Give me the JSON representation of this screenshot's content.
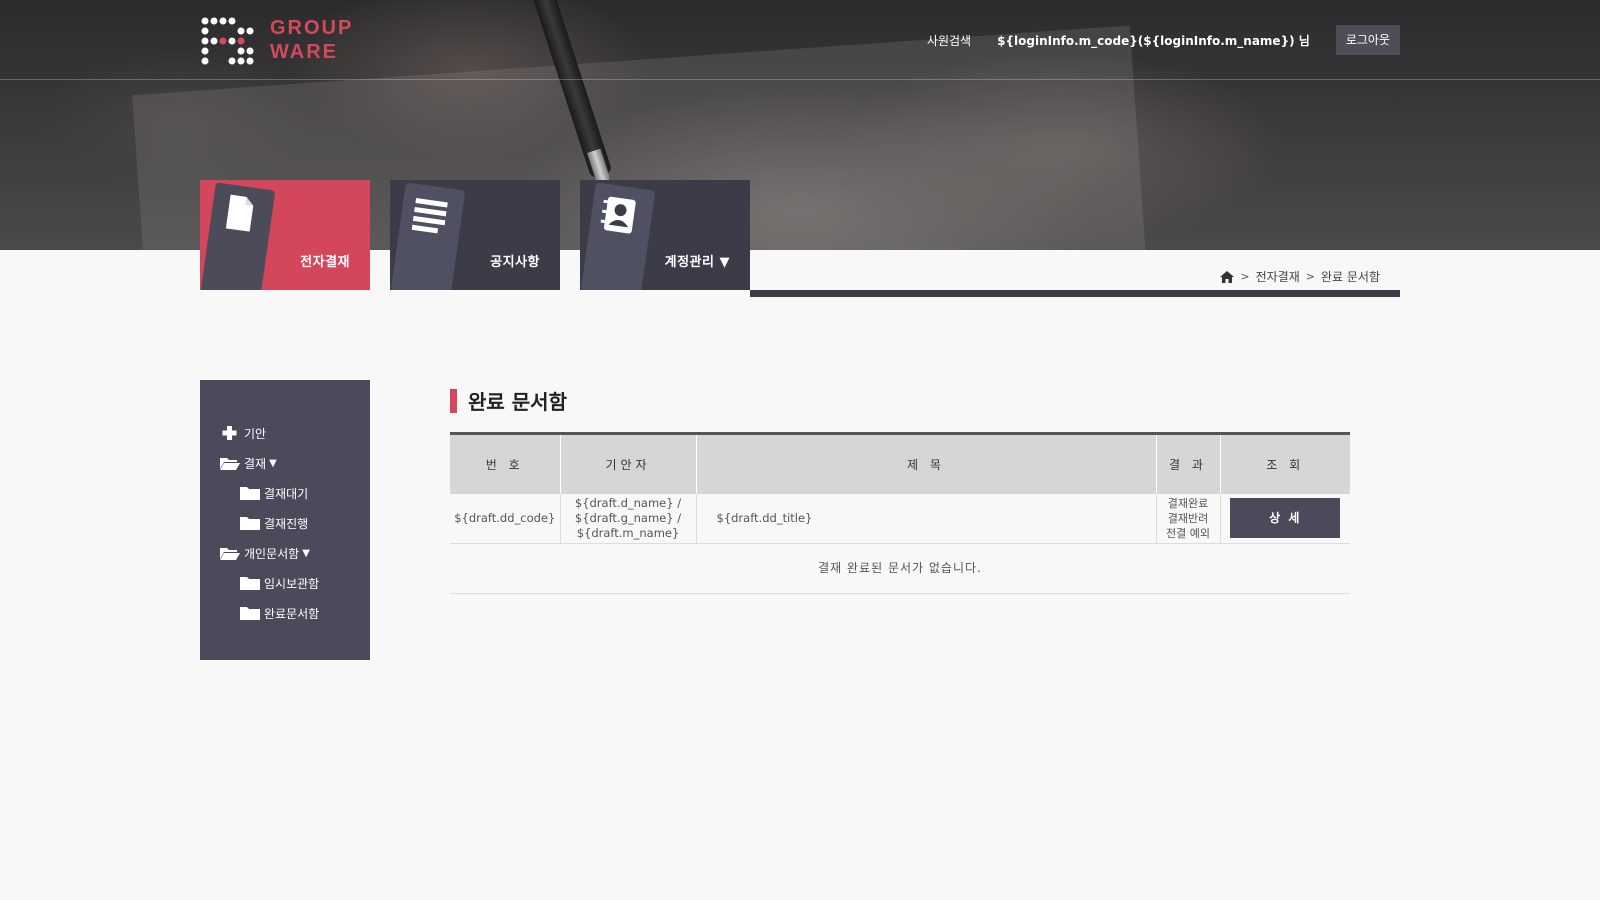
{
  "logo": {
    "line1": "GROUP",
    "line2": "WARE"
  },
  "header": {
    "employee_search": "사원검색",
    "user_display": "${loginInfo.m_code}(${loginInfo.m_name}) 님",
    "logout": "로그아웃"
  },
  "tabs": [
    {
      "label": "전자결재",
      "icon": "document-icon",
      "active": true
    },
    {
      "label": "공지사항",
      "icon": "list-icon",
      "active": false
    },
    {
      "label": "계정관리 ▼",
      "icon": "contact-card-icon",
      "active": false
    }
  ],
  "breadcrumb": {
    "items": [
      "전자결재",
      "완료 문서함"
    ],
    "home_icon": "home-icon"
  },
  "sidebar": {
    "items": [
      {
        "label": "기안",
        "icon": "plus-icon",
        "level": 1
      },
      {
        "label": "결재",
        "icon": "folder-open-icon",
        "level": 1,
        "caret": "▼"
      },
      {
        "label": "결재대기",
        "icon": "folder-icon",
        "level": 2
      },
      {
        "label": "결재진행",
        "icon": "folder-icon",
        "level": 2
      },
      {
        "label": "개인문서함",
        "icon": "folder-open-icon",
        "level": 1,
        "caret": "▼"
      },
      {
        "label": "임시보관함",
        "icon": "folder-icon",
        "level": 2
      },
      {
        "label": "완료문서함",
        "icon": "folder-icon",
        "level": 2
      }
    ]
  },
  "page": {
    "title": "완료 문서함"
  },
  "table": {
    "headers": [
      "번 호",
      "기안자",
      "제 목",
      "결 과",
      "조 회"
    ],
    "row": {
      "code": "${draft.dd_code}",
      "drafter_line1": "${draft.d_name} /",
      "drafter_line2": "${draft.g_name} /",
      "drafter_line3": "${draft.m_name}",
      "title": "${draft.dd_title}",
      "result_line1": "결재완료",
      "result_line2": "결재반려",
      "result_line3": "전결 예외",
      "detail": "상 세"
    },
    "empty_message": "결재 완료된 문서가 없습니다."
  },
  "colors": {
    "accent": "#d4465c",
    "dark": "#3c3c49",
    "sidebar": "#4a4a5b"
  }
}
